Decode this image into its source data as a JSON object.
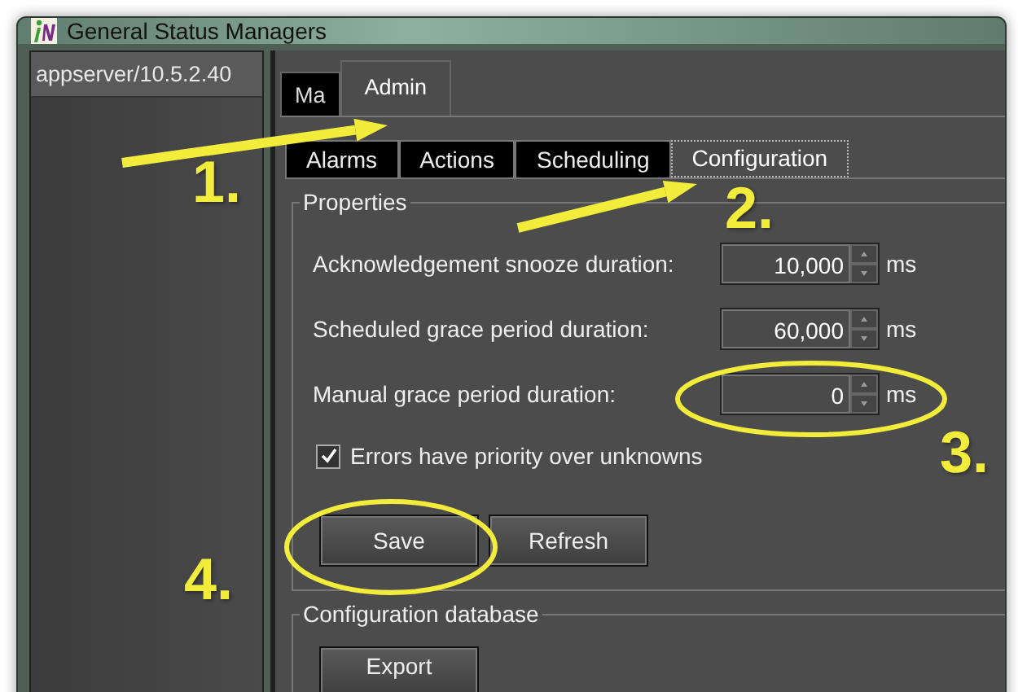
{
  "window": {
    "title": "General Status Managers"
  },
  "sidebar": {
    "header": "appserver/10.5.2.40"
  },
  "tabs": [
    {
      "label": "Ma",
      "selected": false
    },
    {
      "label": "Admin",
      "selected": true
    }
  ],
  "subtabs": [
    {
      "label": "Alarms",
      "selected": false
    },
    {
      "label": "Actions",
      "selected": false
    },
    {
      "label": "Scheduling",
      "selected": false
    },
    {
      "label": "Configuration",
      "selected": true
    }
  ],
  "properties": {
    "title": "Properties",
    "fields": [
      {
        "label": "Acknowledgement snooze duration:",
        "value": "10,000",
        "unit": "ms"
      },
      {
        "label": "Scheduled grace period duration:",
        "value": "60,000",
        "unit": "ms"
      },
      {
        "label": "Manual grace period duration:",
        "value": "0",
        "unit": "ms"
      }
    ],
    "checkbox": {
      "label": "Errors have priority over unknowns",
      "checked": true
    },
    "buttons": [
      "Save",
      "Refresh"
    ]
  },
  "database": {
    "title": "Configuration database",
    "buttons": [
      "Export"
    ]
  },
  "annotations": [
    {
      "kind": "arrow",
      "label": "1."
    },
    {
      "kind": "arrow",
      "label": "2."
    },
    {
      "kind": "ellipse",
      "label": "3."
    },
    {
      "kind": "ellipse",
      "label": "4."
    }
  ]
}
